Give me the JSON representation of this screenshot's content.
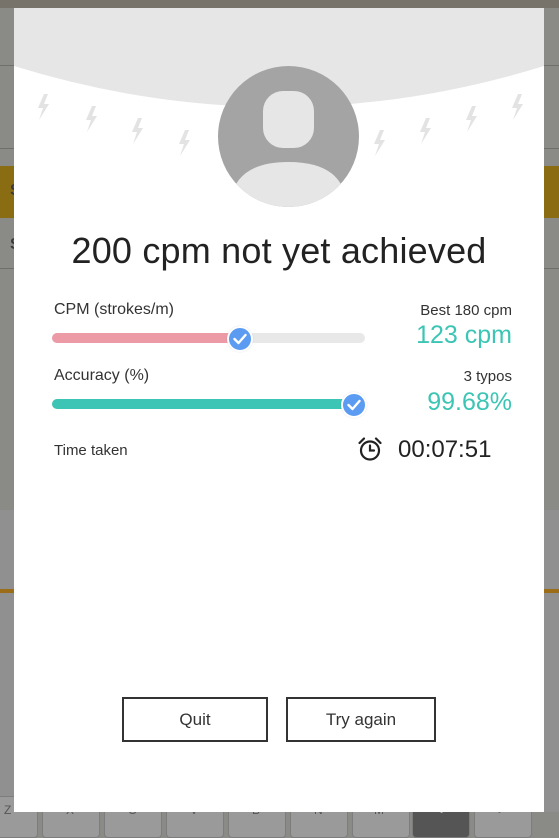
{
  "background": {
    "letters": [
      "S",
      "S"
    ],
    "keys": [
      "Z",
      "X",
      "C",
      "V",
      "B",
      "N",
      "M",
      "<",
      ">"
    ]
  },
  "result": {
    "title": "200 cpm not yet achieved",
    "cpm": {
      "label": "CPM (strokes/m)",
      "best": "Best 180 cpm",
      "value": "123 cpm",
      "progress": 0.6
    },
    "accuracy": {
      "label": "Accuracy (%)",
      "typos": "3 typos",
      "value": "99.68%",
      "progress": 0.9968
    },
    "time": {
      "label": "Time taken",
      "value": "00:07:51"
    }
  },
  "buttons": {
    "quit": "Quit",
    "try_again": "Try again"
  },
  "colors": {
    "accent": "#3cc5b4",
    "cpm_fill": "#ec9aa5",
    "knob": "#5b9cf2"
  },
  "icons": [
    "avatar-icon",
    "check-icon",
    "alarm-clock-icon",
    "lightning-icon"
  ]
}
